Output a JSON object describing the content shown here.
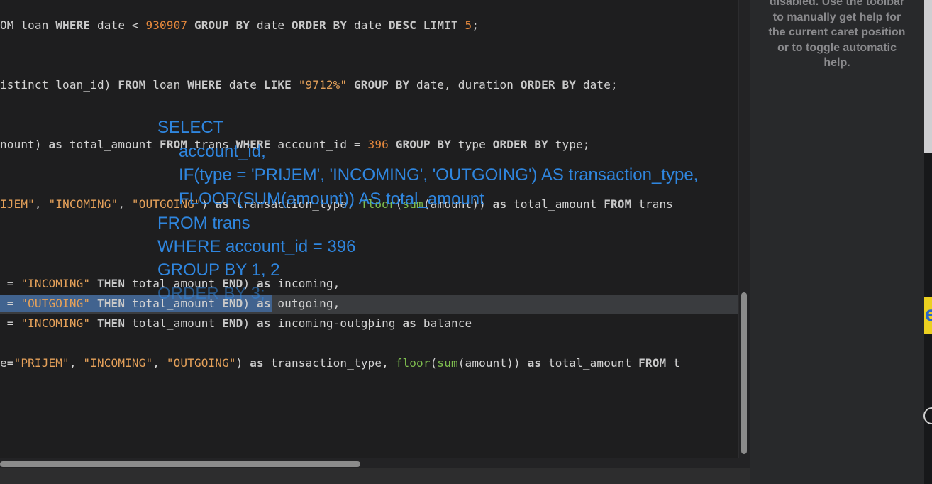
{
  "editor": {
    "lines": [
      [
        {
          "t": "OM loan ",
          "c": ""
        },
        {
          "t": "WHERE",
          "c": "kw"
        },
        {
          "t": " date < ",
          "c": ""
        },
        {
          "t": "930907",
          "c": "num"
        },
        {
          "t": " ",
          "c": ""
        },
        {
          "t": "GROUP BY",
          "c": "kw"
        },
        {
          "t": " date ",
          "c": ""
        },
        {
          "t": "ORDER BY",
          "c": "kw"
        },
        {
          "t": " date ",
          "c": ""
        },
        {
          "t": "DESC LIMIT",
          "c": "kw"
        },
        {
          "t": " ",
          "c": ""
        },
        {
          "t": "5",
          "c": "num"
        },
        {
          "t": ";",
          "c": ""
        }
      ],
      [
        {
          "t": "istinct loan_id) ",
          "c": ""
        },
        {
          "t": "FROM",
          "c": "kw"
        },
        {
          "t": " loan ",
          "c": ""
        },
        {
          "t": "WHERE",
          "c": "kw"
        },
        {
          "t": " date ",
          "c": ""
        },
        {
          "t": "LIKE",
          "c": "kw"
        },
        {
          "t": " ",
          "c": ""
        },
        {
          "t": "\"9712%\"",
          "c": "str"
        },
        {
          "t": " ",
          "c": ""
        },
        {
          "t": "GROUP BY",
          "c": "kw"
        },
        {
          "t": " date, duration ",
          "c": ""
        },
        {
          "t": "ORDER BY",
          "c": "kw"
        },
        {
          "t": " date;",
          "c": ""
        }
      ],
      [
        {
          "t": "nount) ",
          "c": ""
        },
        {
          "t": "as",
          "c": "kw"
        },
        {
          "t": " total_amount ",
          "c": ""
        },
        {
          "t": "FROM",
          "c": "kw"
        },
        {
          "t": " trans ",
          "c": ""
        },
        {
          "t": "WHERE",
          "c": "kw"
        },
        {
          "t": " account_id = ",
          "c": ""
        },
        {
          "t": "396",
          "c": "num"
        },
        {
          "t": " ",
          "c": ""
        },
        {
          "t": "GROUP BY",
          "c": "kw"
        },
        {
          "t": " type ",
          "c": ""
        },
        {
          "t": "ORDER BY",
          "c": "kw"
        },
        {
          "t": " type;",
          "c": ""
        }
      ],
      [
        {
          "t": "IJEM\"",
          "c": "str"
        },
        {
          "t": ", ",
          "c": ""
        },
        {
          "t": "\"INCOMING\"",
          "c": "str"
        },
        {
          "t": ", ",
          "c": ""
        },
        {
          "t": "\"OUTGOING\"",
          "c": "str"
        },
        {
          "t": ") ",
          "c": ""
        },
        {
          "t": "as",
          "c": "kw"
        },
        {
          "t": " transaction_type, ",
          "c": ""
        },
        {
          "t": "floor",
          "c": "fn"
        },
        {
          "t": "(",
          "c": ""
        },
        {
          "t": "sum",
          "c": "fn"
        },
        {
          "t": "(amount)) ",
          "c": ""
        },
        {
          "t": "as",
          "c": "kw"
        },
        {
          "t": " total_amount ",
          "c": ""
        },
        {
          "t": "FROM",
          "c": "kw"
        },
        {
          "t": " trans",
          "c": ""
        }
      ],
      [
        {
          "t": " = ",
          "c": ""
        },
        {
          "t": "\"INCOMING\"",
          "c": "str"
        },
        {
          "t": " ",
          "c": ""
        },
        {
          "t": "THEN",
          "c": "kw"
        },
        {
          "t": " total_amount ",
          "c": ""
        },
        {
          "t": "END",
          "c": "kw"
        },
        {
          "t": ") ",
          "c": ""
        },
        {
          "t": "as",
          "c": "kw"
        },
        {
          "t": " incoming,",
          "c": ""
        }
      ],
      [
        {
          "t": " = ",
          "c": ""
        },
        {
          "t": "\"OUTGOING\"",
          "c": "str"
        },
        {
          "t": " ",
          "c": ""
        },
        {
          "t": "THEN",
          "c": "kw"
        },
        {
          "t": " total_amount ",
          "c": ""
        },
        {
          "t": "END",
          "c": "kw"
        },
        {
          "t": ") ",
          "c": ""
        },
        {
          "t": "as",
          "c": "kw"
        },
        {
          "t": " outgoing,",
          "c": ""
        }
      ],
      [
        {
          "t": " = ",
          "c": ""
        },
        {
          "t": "\"INCOMING\"",
          "c": "str"
        },
        {
          "t": " ",
          "c": ""
        },
        {
          "t": "THEN",
          "c": "kw"
        },
        {
          "t": " total_amount ",
          "c": ""
        },
        {
          "t": "END",
          "c": "kw"
        },
        {
          "t": ") ",
          "c": ""
        },
        {
          "t": "as",
          "c": "kw"
        },
        {
          "t": " incoming-outgoing ",
          "c": ""
        },
        {
          "t": "as",
          "c": "kw"
        },
        {
          "t": " balance",
          "c": ""
        }
      ],
      [
        {
          "t": "e=",
          "c": ""
        },
        {
          "t": "\"PRIJEM\"",
          "c": "str"
        },
        {
          "t": ", ",
          "c": ""
        },
        {
          "t": "\"INCOMING\"",
          "c": "str"
        },
        {
          "t": ", ",
          "c": ""
        },
        {
          "t": "\"OUTGOING\"",
          "c": "str"
        },
        {
          "t": ") ",
          "c": ""
        },
        {
          "t": "as",
          "c": "kw"
        },
        {
          "t": " transaction_type, ",
          "c": ""
        },
        {
          "t": "floor",
          "c": "fn"
        },
        {
          "t": "(",
          "c": ""
        },
        {
          "t": "sum",
          "c": "fn"
        },
        {
          "t": "(amount)) ",
          "c": ""
        },
        {
          "t": "as",
          "c": "kw"
        },
        {
          "t": " total_amount ",
          "c": ""
        },
        {
          "t": "FROM",
          "c": "kw"
        },
        {
          "t": " t",
          "c": ""
        }
      ]
    ]
  },
  "overlay": {
    "lines": [
      "SELECT",
      "account_id,",
      "IF(type = 'PRIJEM', 'INCOMING', 'OUTGOING') AS transaction_type,",
      "FLOOR(SUM(amount)) AS total_amount",
      "FROM trans",
      "WHERE account_id = 396",
      "GROUP BY 1, 2",
      "ORDER BY 3;"
    ]
  },
  "help_panel": {
    "lines": [
      "disabled. Use the toolbar",
      "to manually get help for",
      "the current caret position",
      "or to toggle automatic",
      "help."
    ]
  },
  "right_strip": {
    "badge_letter": "e"
  },
  "colors": {
    "editor_bg": "#1e1e1f",
    "keyword": "#c8c8c8",
    "number": "#e5883c",
    "string": "#e5a15a",
    "function": "#7fbf4f",
    "selection": "#41638f",
    "current_line": "#3a3c3f",
    "overlay_text": "#2f86df",
    "help_text": "#8a8a8d"
  }
}
